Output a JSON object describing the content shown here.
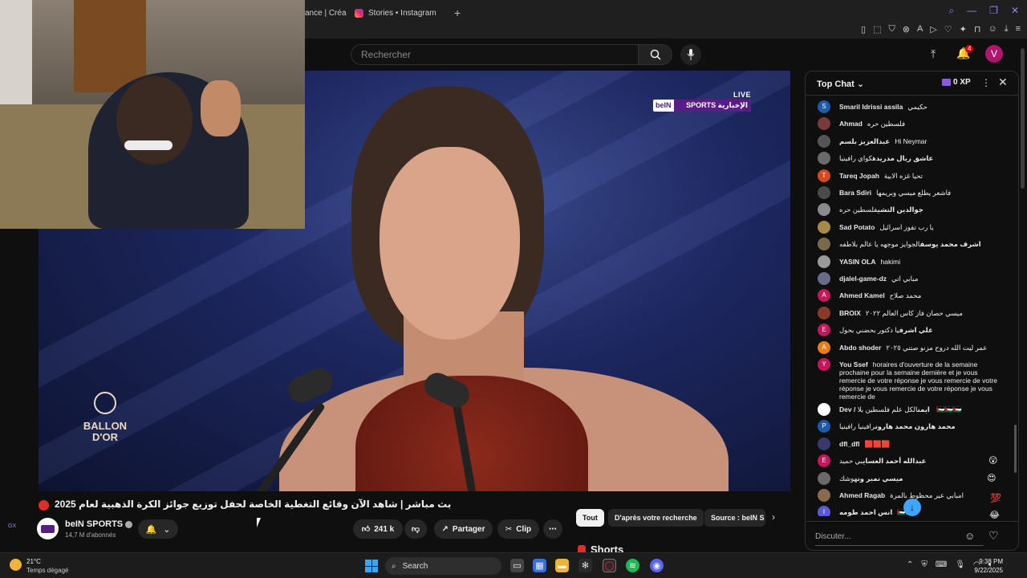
{
  "browser": {
    "tabs": [
      {
        "label": "ance | Créa"
      },
      {
        "label": "Stories • Instagram",
        "icon": "instagram-icon"
      }
    ],
    "new_tab": "+"
  },
  "header": {
    "search_placeholder": "Rechercher",
    "notifications_count": "4",
    "avatar_letter": "V"
  },
  "video": {
    "live_label": "LIVE",
    "broadcaster_logo_left": "beIN",
    "broadcaster_logo_right": "SPORTS الإخبارية",
    "event_logo_line1": "BALLON",
    "event_logo_line2": "D'OR",
    "title": "بث مباشر | شاهد الآن وقائع التغطية الخاصة لحفل توزيع جوائز الكرة الذهبية لعام 2025"
  },
  "channel": {
    "name": "beIN SPORTS",
    "subscribers": "14,7 M d'abonnés"
  },
  "actions": {
    "likes": "241 k",
    "share": "Partager",
    "clip": "Clip",
    "more": "⋯"
  },
  "chips": [
    "Tout",
    "D'après votre recherche",
    "Source : beIN S"
  ],
  "shorts_label": "Shorts",
  "left_guide": {
    "label": "GX"
  },
  "chat": {
    "title": "Top Chat",
    "xp": "0 XP",
    "input_placeholder": "Discuter...",
    "messages": [
      {
        "author": "Smaril Idrissi assila",
        "text": "حكيمي",
        "avatar_letter": "S",
        "avatar_color": "#1e5aa8"
      },
      {
        "author": "Ahmad",
        "text": "فلسطين حره",
        "avatar_letter": "",
        "avatar_color": "#7a3a3a"
      },
      {
        "author": "عبدالعزيز بلسم",
        "text": "Hi Neymar",
        "avatar_letter": "",
        "avatar_color": "#555555"
      },
      {
        "author": "عاشق ريال مدريد",
        "text": "هكواي رافينيا",
        "avatar_letter": "",
        "avatar_color": "#6a6a6a"
      },
      {
        "author": "Tareq Jopah",
        "text": "تحيا غزه الابية",
        "avatar_letter": "T",
        "avatar_color": "#d44a1f"
      },
      {
        "author": "Bara Sdiri",
        "text": "فاشعر يطلع ميسي وبريمها",
        "avatar_letter": "",
        "avatar_color": "#4a4a4a"
      },
      {
        "author": "جوالدين التشي",
        "text": "فلسطين حره",
        "avatar_letter": "",
        "avatar_color": "#8a8a8a"
      },
      {
        "author": "Sad Potato",
        "text": "يا رب تفوز اسرائيل",
        "avatar_letter": "",
        "avatar_color": "#a58a4a"
      },
      {
        "author": "اشرف محمد يوسف",
        "text": "الجوايز موجهه يا عالم بلاطفه",
        "avatar_letter": "",
        "avatar_color": "#7a6a4a"
      },
      {
        "author": "YASIN OLA",
        "text": "hakimi",
        "avatar_letter": "",
        "avatar_color": "#9a9a9a"
      },
      {
        "author": "djalel-game-dz",
        "text": "مبابي اتي",
        "avatar_letter": "",
        "avatar_color": "#6a6a8a"
      },
      {
        "author": "Ahmed Kamel",
        "text": "محمد صلاح",
        "avatar_letter": "A",
        "avatar_color": "#c2185b"
      },
      {
        "author": "BROIX",
        "text": "ميسي حصان فاز كاس العالم ٢٠٢٢",
        "avatar_letter": "",
        "avatar_color": "#8a3a2a"
      },
      {
        "author": "علي اشرف",
        "text": "يا دكتور بحضني بحول",
        "avatar_letter": "E",
        "avatar_color": "#c2185b"
      },
      {
        "author": "Abdo shoder",
        "text": "عمر ليت الله دروح مزنو صتني ٢٠٢٥",
        "avatar_letter": "A",
        "avatar_color": "#e67c1a"
      },
      {
        "author": "You Ssef",
        "text": "horaires d'ouverture de la semaine prochaine pour la semaine dernière et je vous remercie de votre réponse je vous remercie de votre réponse je vous remercie de votre réponse je vous remercie de",
        "avatar_letter": "Y",
        "avatar_color": "#c2185b"
      },
      {
        "author": "Dev / ايمن",
        "text": "الكل علم فلسطين بلا 🇵🇸🇵🇸🇵🇸",
        "avatar_letter": "",
        "avatar_color": "#ffffff"
      },
      {
        "author": "محمد هارون محمد هارون",
        "text": "رافينيا رافينيا",
        "avatar_letter": "P",
        "avatar_color": "#1e5aa8"
      },
      {
        "author": "dfl_dfl",
        "text": "🟥🟥🟥",
        "avatar_letter": "",
        "avatar_color": "#3a3a6a"
      },
      {
        "author": "عبدالله أحمد العساي",
        "text": "بي حميد",
        "avatar_letter": "E",
        "avatar_color": "#c2185b"
      },
      {
        "author": "ميسي نمبر ون",
        "text": "هوشك",
        "avatar_letter": "",
        "avatar_color": "#6a6a6a"
      },
      {
        "author": "Ahmed Ragab",
        "text": "امبابي عبر محظوط بالمرة",
        "avatar_letter": "",
        "avatar_color": "#8a6a4a"
      },
      {
        "author": "انس احمد طومه",
        "text": "🇵🇸🇵🇸",
        "avatar_letter": "I",
        "avatar_color": "#5a5ad8"
      }
    ]
  },
  "taskbar": {
    "temp": "21°C",
    "weather": "Temps dégagé",
    "search": "Search",
    "time": "9:38 PM",
    "date": "9/22/2025"
  },
  "colors": {
    "background": "#0f0f0f",
    "accent_red": "#e22c2c",
    "link_blue": "#3ea6ff",
    "bein_purple": "#5a1d86"
  }
}
